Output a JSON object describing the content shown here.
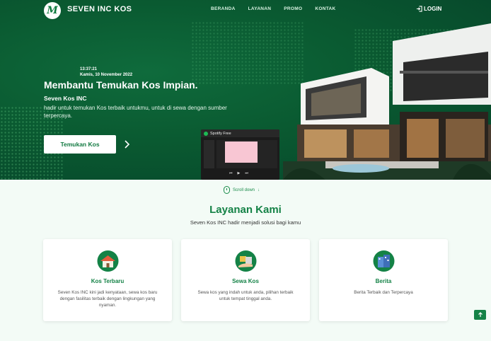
{
  "nav": {
    "brand": "SEVEN INC KOS",
    "logo_letter": "M",
    "menu": [
      "BERANDA",
      "LAYANAN",
      "PROMO",
      "KONTAK"
    ],
    "login": "LOGIN"
  },
  "hero": {
    "time": "13:37:21",
    "date": "Kamis, 10 November 2022",
    "headline": "Membantu Temukan Kos Impian.",
    "subhead": "Seven Kos INC",
    "description": "hadir untuk temukan Kos terbaik untukmu, untuk di sewa dengan sumber terpercaya.",
    "cta": "Temukan Kos"
  },
  "spotify": {
    "title": "Spotify Free"
  },
  "scroll": {
    "label": "Scroll down"
  },
  "services": {
    "title": "Layanan Kami",
    "subtitle": "Seven Kos INC hadir menjadi solusi bagi kamu",
    "cards": [
      {
        "title": "Kos Terbaru",
        "desc": "Seven Kos INC kini jadi kenyataan, sewa kos baru dengan fasilitas terbaik dengan lingkungan yang nyaman.",
        "icon": "house-icon"
      },
      {
        "title": "Sewa Kos",
        "desc": "Sewa kos yang indah untuk anda, pilihan terbaik untuk tempat tinggal anda.",
        "icon": "rent-icon"
      },
      {
        "title": "Berita",
        "desc": "Berita Terbaik dan Terpercaya",
        "icon": "building-icon"
      }
    ]
  },
  "colors": {
    "primary": "#148246",
    "hero_bg": "#0a5a31",
    "spotify_green": "#1db954"
  }
}
